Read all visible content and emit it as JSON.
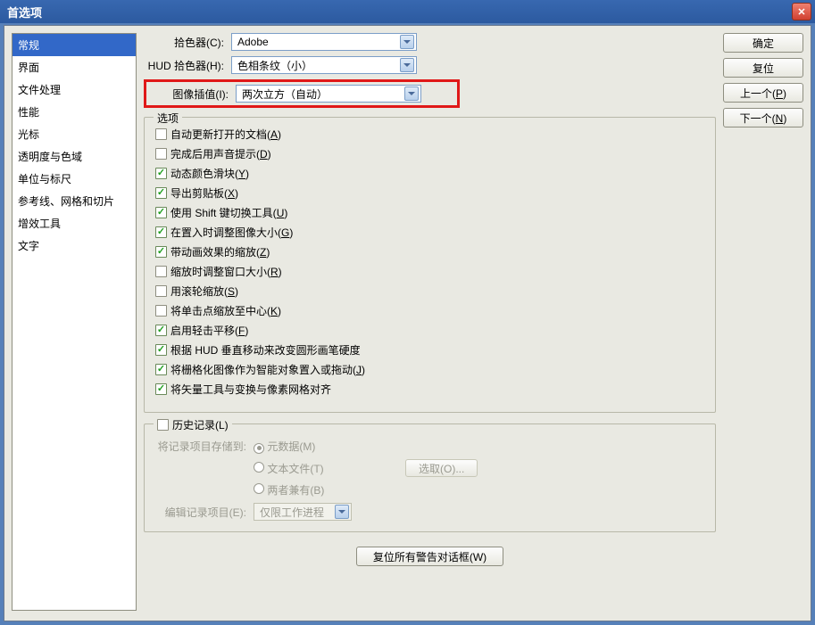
{
  "window": {
    "title": "首选项"
  },
  "sidebar": {
    "items": [
      {
        "label": "常规",
        "selected": true
      },
      {
        "label": "界面",
        "selected": false
      },
      {
        "label": "文件处理",
        "selected": false
      },
      {
        "label": "性能",
        "selected": false
      },
      {
        "label": "光标",
        "selected": false
      },
      {
        "label": "透明度与色域",
        "selected": false
      },
      {
        "label": "单位与标尺",
        "selected": false
      },
      {
        "label": "参考线、网格和切片",
        "selected": false
      },
      {
        "label": "增效工具",
        "selected": false
      },
      {
        "label": "文字",
        "selected": false
      }
    ]
  },
  "buttons": {
    "ok": "确定",
    "cancel": "复位",
    "prev": "上一个(P)",
    "next": "下一个(N)"
  },
  "pickers": {
    "colorPicker": {
      "label": "拾色器(C):",
      "value": "Adobe"
    },
    "hudPicker": {
      "label": "HUD 拾色器(H):",
      "value": "色相条纹（小）"
    },
    "interpolation": {
      "label": "图像插值(I):",
      "value": "两次立方（自动）"
    }
  },
  "options": {
    "legend": "选项",
    "items": [
      {
        "checked": false,
        "label": "自动更新打开的文档(A)"
      },
      {
        "checked": false,
        "label": "完成后用声音提示(D)"
      },
      {
        "checked": true,
        "label": "动态颜色滑块(Y)"
      },
      {
        "checked": true,
        "label": "导出剪贴板(X)"
      },
      {
        "checked": true,
        "label": "使用 Shift 键切换工具(U)"
      },
      {
        "checked": true,
        "label": "在置入时调整图像大小(G)"
      },
      {
        "checked": true,
        "label": "带动画效果的缩放(Z)"
      },
      {
        "checked": false,
        "label": "缩放时调整窗口大小(R)"
      },
      {
        "checked": false,
        "label": "用滚轮缩放(S)"
      },
      {
        "checked": false,
        "label": "将单击点缩放至中心(K)"
      },
      {
        "checked": true,
        "label": "启用轻击平移(F)"
      },
      {
        "checked": true,
        "label": "根据 HUD 垂直移动来改变圆形画笔硬度"
      },
      {
        "checked": true,
        "label": "将栅格化图像作为智能对象置入或拖动(J)"
      },
      {
        "checked": true,
        "label": "将矢量工具与变换与像素网格对齐"
      }
    ]
  },
  "history": {
    "legend": "历史记录(L)",
    "legendChecked": false,
    "saveToLabel": "将记录项目存储到:",
    "radios": [
      {
        "label": "元数据(M)",
        "checked": true
      },
      {
        "label": "文本文件(T)",
        "checked": false
      },
      {
        "label": "两者兼有(B)",
        "checked": false
      }
    ],
    "chooseBtn": "选取(O)...",
    "editLabel": "编辑记录项目(E):",
    "editValue": "仅限工作进程"
  },
  "resetWarnings": "复位所有警告对话框(W)"
}
